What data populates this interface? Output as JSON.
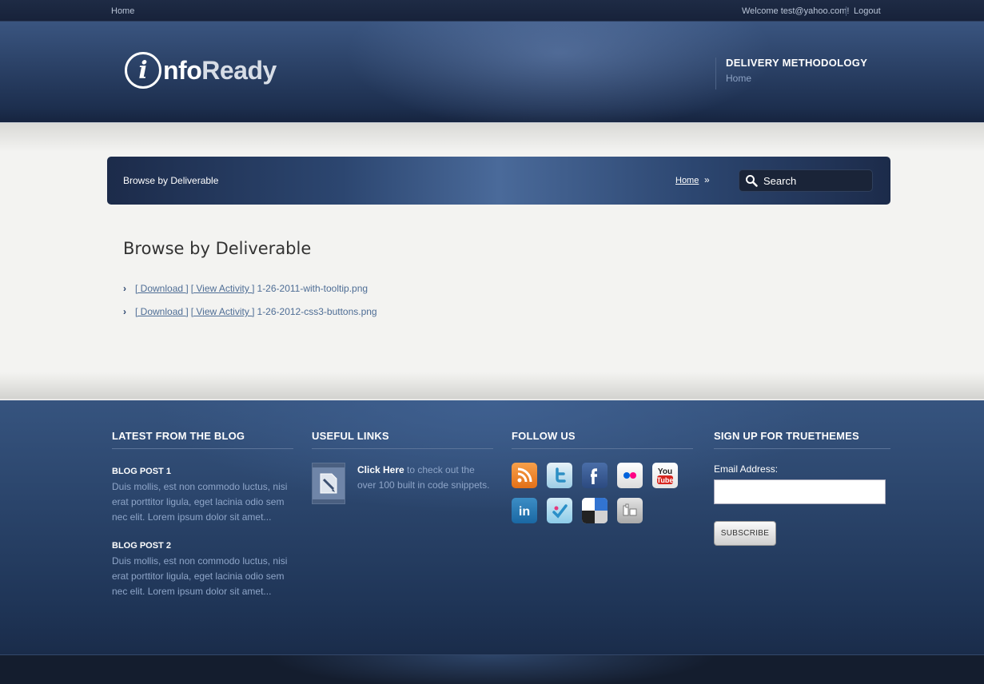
{
  "topbar": {
    "home": "Home",
    "welcome": "Welcome test@yahoo.com!",
    "logout": "Logout"
  },
  "header": {
    "logo_letter": "i",
    "logo_word1": "nfo",
    "logo_word2": "Ready",
    "title": "DELIVERY METHODOLOGY",
    "home": "Home"
  },
  "navbar": {
    "breadcrumb": "Browse by Deliverable",
    "home_link": "Home",
    "separator": "»",
    "search_placeholder": "Search"
  },
  "main": {
    "title": "Browse by Deliverable",
    "files": [
      {
        "download": "[ Download ]",
        "activity": "[ View Activity ]",
        "name": "1-26-2011-with-tooltip.png"
      },
      {
        "download": "[ Download ]",
        "activity": "[ View Activity ]",
        "name": "1-26-2012-css3-buttons.png"
      }
    ]
  },
  "footer": {
    "blog": {
      "heading": "LATEST FROM THE BLOG",
      "posts": [
        {
          "title": "BLOG POST 1",
          "body": "Duis mollis, est non commodo luctus, nisi erat porttitor ligula, eget lacinia odio sem nec elit. Lorem ipsum dolor sit amet..."
        },
        {
          "title": "BLOG POST 2",
          "body": "Duis mollis, est non commodo luctus, nisi erat porttitor ligula, eget lacinia odio sem nec elit. Lorem ipsum dolor sit amet..."
        }
      ]
    },
    "links": {
      "heading": "USEFUL LINKS",
      "click_here": "Click Here",
      "rest": " to check out the over 100 built in code snippets."
    },
    "follow": {
      "heading": "FOLLOW US",
      "icons": [
        "rss-icon",
        "twitter-icon",
        "facebook-icon",
        "flickr-icon",
        "youtube-icon",
        "linkedin-icon",
        "foursquare-icon",
        "delicious-icon",
        "digg-icon"
      ]
    },
    "signup": {
      "heading": "SIGN UP FOR TRUETHEMES",
      "email_label": "Email Address:",
      "subscribe": "SUBSCRIBE"
    }
  }
}
